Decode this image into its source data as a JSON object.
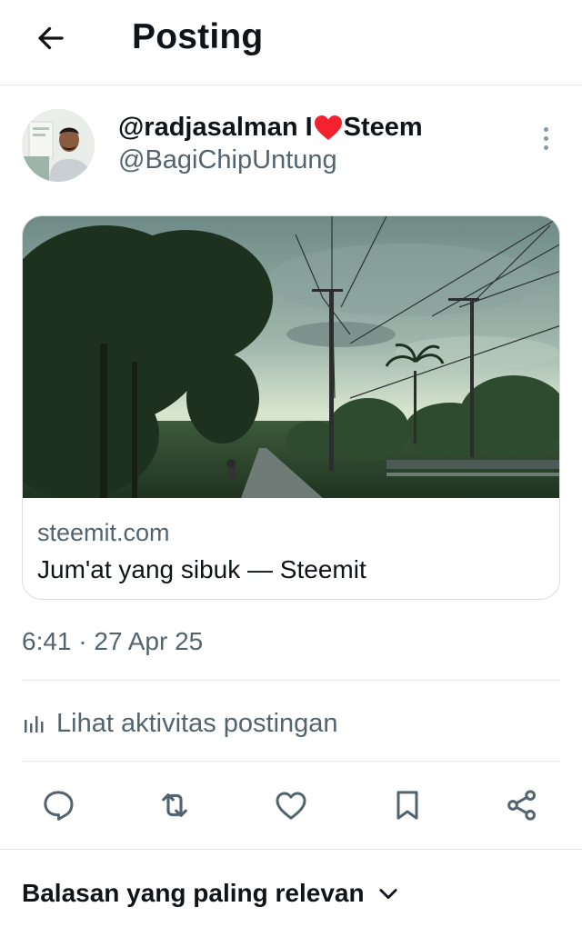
{
  "header": {
    "back_icon": "arrow-left-icon",
    "title": "Posting"
  },
  "author": {
    "display_name_prefix": "@radjasalman I",
    "display_name_emoji": "heart-emoji",
    "display_name_suffix": "Steem",
    "handle": "@BagiChipUntung",
    "more_icon": "more-vertical-icon"
  },
  "link_card": {
    "domain": "steemit.com",
    "title": "Jum'at yang sibuk — Steemit"
  },
  "post": {
    "timestamp": "6:41 · 27 Apr 25",
    "activity_label": "Lihat aktivitas postingan"
  },
  "actions": [
    {
      "name": "reply",
      "icon": "reply-icon"
    },
    {
      "name": "repost",
      "icon": "repost-icon"
    },
    {
      "name": "like",
      "icon": "heart-outline-icon"
    },
    {
      "name": "bookmark",
      "icon": "bookmark-icon"
    },
    {
      "name": "share",
      "icon": "share-icon"
    }
  ],
  "replies": {
    "sort_label": "Balasan yang paling relevan",
    "sort_icon": "chevron-down-icon"
  },
  "colors": {
    "text_primary": "#0f1419",
    "text_secondary": "#536471",
    "divider": "#e6e9ec",
    "heart": "#f4212e"
  }
}
